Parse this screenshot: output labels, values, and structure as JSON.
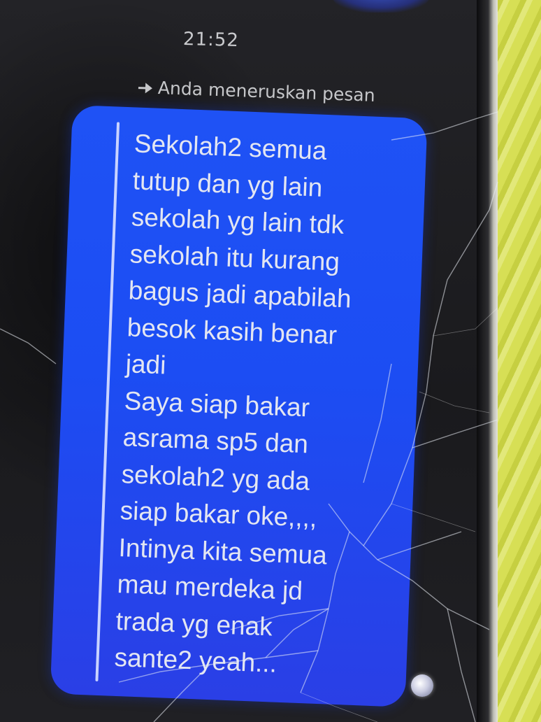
{
  "chat": {
    "timestamp": "21:52",
    "forwarded_label": "Anda meneruskan pesan",
    "forward_icon": "forward-arrow-icon",
    "bubble_color": "#1f52f5",
    "message_lines": [
      "Sekolah2 semua",
      "tutup dan yg lain",
      "sekolah yg lain tdk",
      "sekolah itu kurang",
      "bagus jadi apabilah",
      "besok kasih benar",
      "jadi",
      "Saya siap bakar",
      "asrama sp5 dan",
      "sekolah2 yg ada",
      "siap bakar oke,,,,",
      "Intinya kita semua",
      "mau merdeka  jd",
      "trada yg enak",
      "sante2 yeah..."
    ],
    "seen_indicator_icon": "seen-avatar-icon"
  }
}
